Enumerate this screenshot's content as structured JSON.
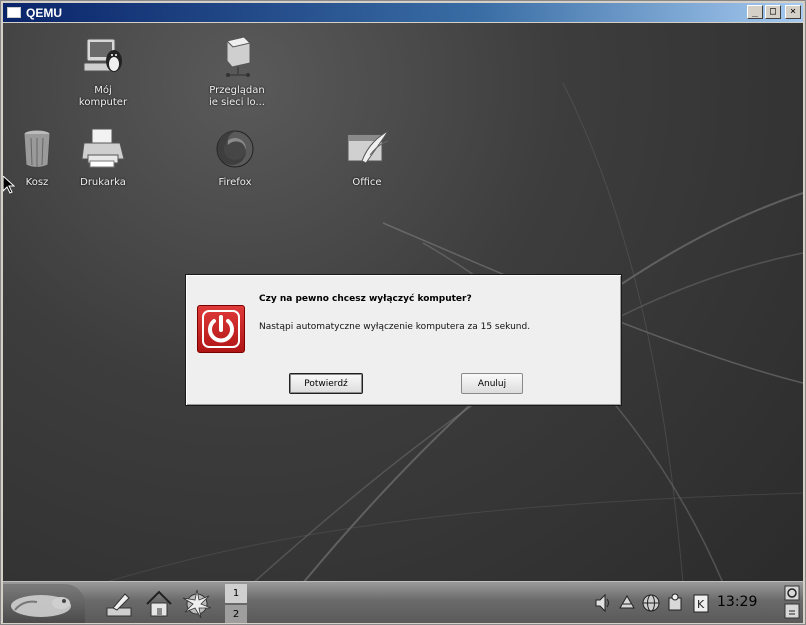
{
  "window": {
    "title": "QEMU",
    "buttons": {
      "minimize": "_",
      "maximize": "□",
      "close": "×"
    }
  },
  "desktop": {
    "icons": [
      {
        "label_line1": "Mój",
        "label_line2": "komputer",
        "icon": "my-computer-icon"
      },
      {
        "label_line1": "Przeglądan",
        "label_line2": "ie sieci lo...",
        "icon": "network-browser-icon"
      },
      {
        "label_line1": "Kosz",
        "icon": "trash-icon"
      },
      {
        "label_line1": "Drukarka",
        "icon": "printer-icon"
      },
      {
        "label_line1": "Firefox",
        "icon": "firefox-icon"
      },
      {
        "label_line1": "Office",
        "icon": "office-icon"
      }
    ]
  },
  "dialog": {
    "title": "Czy na pewno chcesz wyłączyć komputer?",
    "message": "Nastąpi automatyczne wyłączenie komputera za 15 sekund.",
    "confirm_label": "Potwierdź",
    "cancel_label": "Anuluj",
    "icon": "power-icon"
  },
  "taskbar": {
    "pager": [
      "1",
      "2"
    ],
    "clock": "13:29",
    "tray_icons": [
      "speaker-icon",
      "network-tray-icon",
      "globe-tray-icon",
      "update-tray-icon",
      "klipper-icon"
    ]
  },
  "colors": {
    "dialog_bg": "#efefef",
    "power_red": "#d01f1f",
    "titlebar": "#0a246a"
  }
}
